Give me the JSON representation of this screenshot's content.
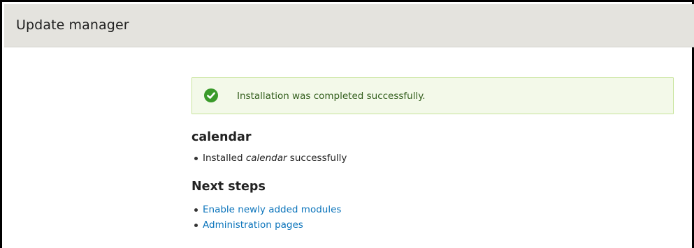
{
  "header": {
    "title": "Update manager"
  },
  "status": {
    "type": "success",
    "icon": "check-circle-icon",
    "message": "Installation was completed successfully.",
    "color": "#3a9a2a"
  },
  "project": {
    "heading": "calendar",
    "result_prefix": "Installed ",
    "result_module": "calendar",
    "result_suffix": " successfully"
  },
  "next_steps": {
    "heading": "Next steps",
    "links": [
      {
        "label": "Enable newly added modules"
      },
      {
        "label": "Administration pages"
      }
    ]
  },
  "colors": {
    "header_bg": "#e4e3de",
    "link": "#0b74bb",
    "success_bg": "#f3f9e9",
    "success_border": "#c7e39a"
  }
}
